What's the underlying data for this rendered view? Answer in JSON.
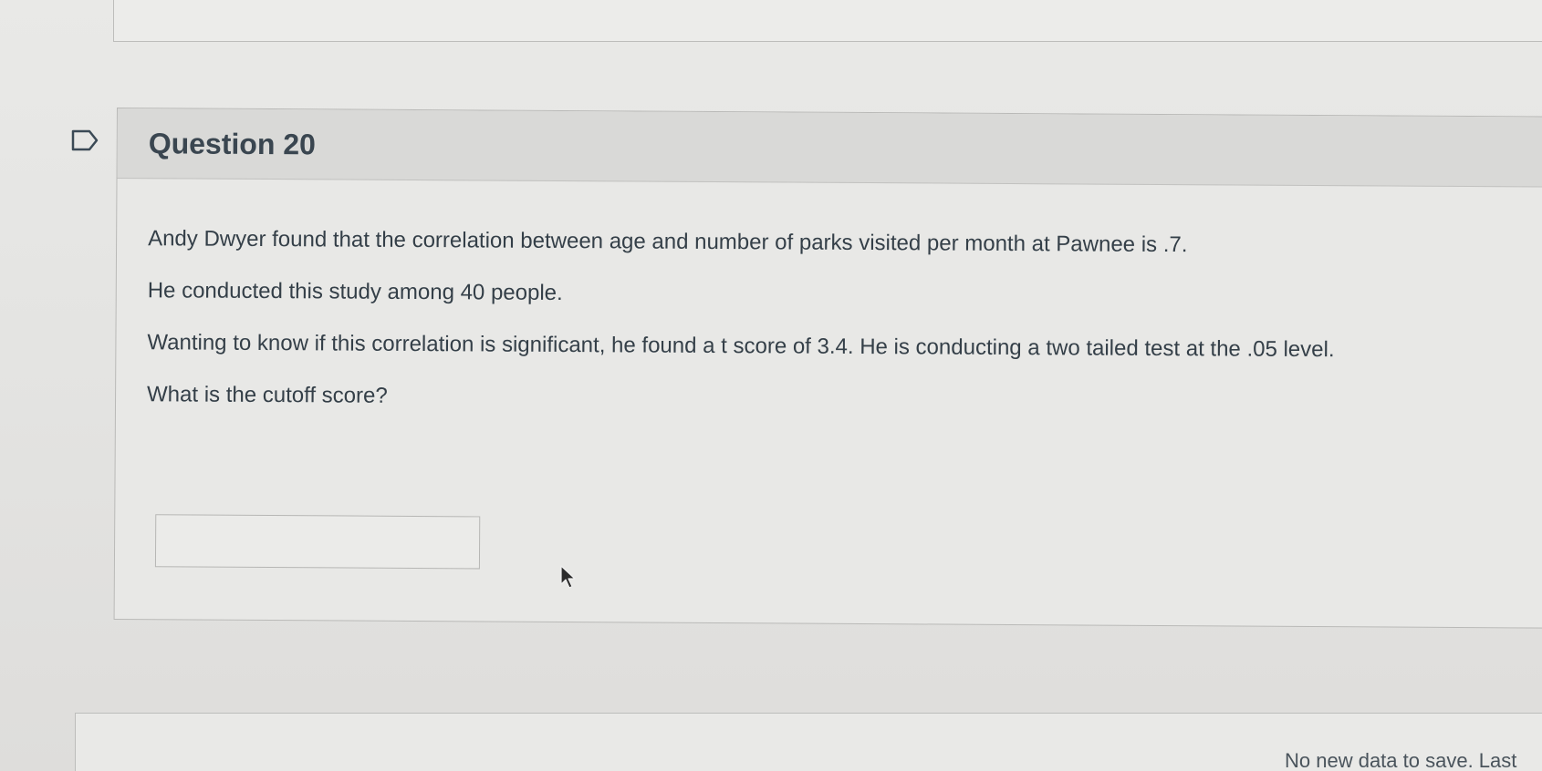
{
  "question": {
    "title": "Question 20",
    "lines": [
      "Andy Dwyer found that the correlation between age and number of parks visited per month at Pawnee is .7.",
      "He conducted this study among 40 people.",
      "Wanting to know if this correlation is significant, he found a t score of 3.4. He is conducting a two tailed test at the .05 level.",
      "What is the cutoff score?"
    ],
    "answer": {
      "value": "",
      "placeholder": ""
    }
  },
  "footer": {
    "save_status": "No new data to save. Last"
  },
  "icons": {
    "flag": "flag-question-icon",
    "cursor": "mouse-pointer-icon"
  }
}
